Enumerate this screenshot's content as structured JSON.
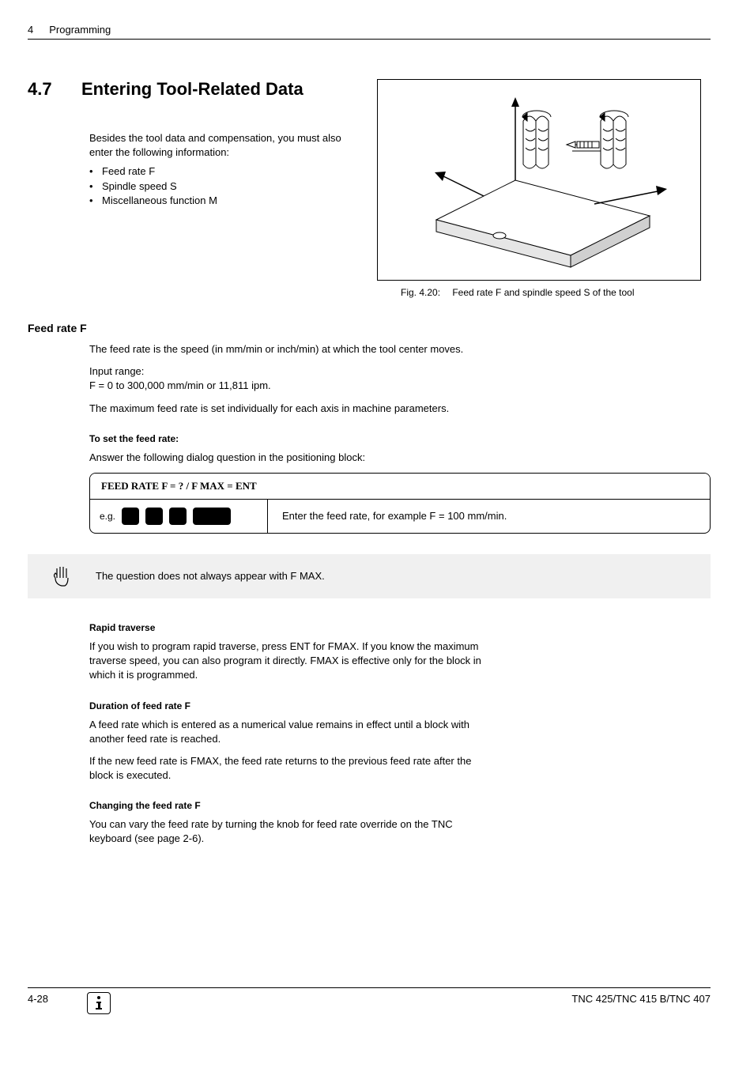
{
  "header": {
    "chapter_num": "4",
    "chapter_title": "Programming"
  },
  "section": {
    "number": "4.7",
    "title": "Entering Tool-Related Data"
  },
  "intro": {
    "text": "Besides the tool data and compensation, you must also enter the following information:",
    "bullets": [
      "Feed rate F",
      "Spindle speed S",
      "Miscellaneous function M"
    ]
  },
  "figure": {
    "label": "Fig. 4.20:",
    "caption": "Feed rate F and spindle speed S of the tool"
  },
  "feed_rate": {
    "heading": "Feed rate F",
    "p1": "The feed rate is the speed (in mm/min or inch/min) at which the tool center moves.",
    "p2a": "Input range:",
    "p2b": "F = 0 to 300,000 mm/min or 11,811 ipm.",
    "p3": "The maximum feed rate is set individually for each axis in machine parameters.",
    "to_set_heading": "To set the feed rate:",
    "to_set_text": "Answer the following dialog question in the positioning block:",
    "dialog_header": "FEED RATE F = ? / F MAX = ENT",
    "eg_label": "e.g.",
    "dialog_desc": "Enter the feed rate, for example F = 100 mm/min."
  },
  "note": {
    "text": "The question does not always appear with F MAX."
  },
  "rapid": {
    "heading": "Rapid traverse",
    "text": "If you wish to program rapid traverse, press ENT for FMAX. If you know the maximum traverse speed, you can also program it directly. FMAX is effective only for the block in which it is programmed."
  },
  "duration": {
    "heading": "Duration of feed rate F",
    "p1": "A feed rate which is entered as a numerical value remains in effect until a block with another feed rate is reached.",
    "p2": "If the new feed rate is FMAX, the feed rate returns to the previous feed rate after the block is executed."
  },
  "changing": {
    "heading": "Changing the feed rate F",
    "text": "You can vary the feed rate by turning the knob for feed rate override on the TNC keyboard (see page 2-6)."
  },
  "footer": {
    "page": "4-28",
    "product": "TNC 425/TNC 415 B/TNC 407"
  }
}
